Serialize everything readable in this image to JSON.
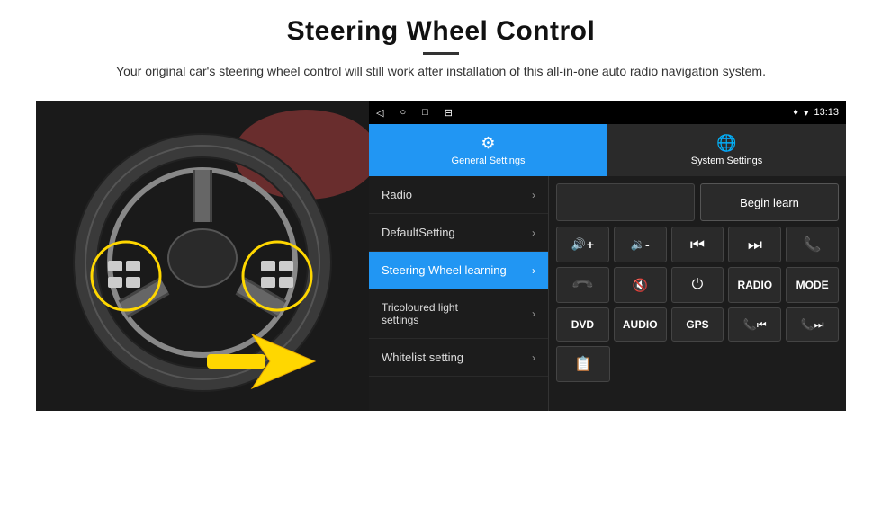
{
  "header": {
    "title": "Steering Wheel Control",
    "subtitle": "Your original car's steering wheel control will still work after installation of this all-in-one auto radio navigation system."
  },
  "tabs": [
    {
      "id": "general",
      "label": "General Settings",
      "active": true
    },
    {
      "id": "system",
      "label": "System Settings",
      "active": false
    }
  ],
  "status_bar": {
    "time": "13:13",
    "nav_icons": [
      "◁",
      "○",
      "□",
      "⊟"
    ]
  },
  "menu": {
    "items": [
      {
        "label": "Radio",
        "active": false
      },
      {
        "label": "DefaultSetting",
        "active": false
      },
      {
        "label": "Steering Wheel learning",
        "active": true
      },
      {
        "label": "Tricoloured light settings",
        "active": false
      },
      {
        "label": "Whitelist setting",
        "active": false
      }
    ]
  },
  "panel": {
    "begin_learn_label": "Begin learn",
    "controls": [
      {
        "type": "icon",
        "icon": "🔊+"
      },
      {
        "type": "icon",
        "icon": "🔉-"
      },
      {
        "type": "icon",
        "icon": "⏮"
      },
      {
        "type": "icon",
        "icon": "⏭"
      },
      {
        "type": "icon",
        "icon": "📞"
      },
      {
        "type": "icon",
        "icon": "📞"
      },
      {
        "type": "icon",
        "icon": "🔇"
      },
      {
        "type": "icon",
        "icon": "⏻"
      },
      {
        "type": "text",
        "label": "RADIO"
      },
      {
        "type": "text",
        "label": "MODE"
      }
    ],
    "bottom_row": [
      {
        "type": "text",
        "label": "DVD"
      },
      {
        "type": "text",
        "label": "AUDIO"
      },
      {
        "type": "text",
        "label": "GPS"
      },
      {
        "type": "icon",
        "icon": "📞⏮"
      },
      {
        "type": "icon",
        "icon": "📞⏭"
      }
    ],
    "last_row": [
      {
        "type": "icon",
        "icon": "📋"
      }
    ]
  }
}
